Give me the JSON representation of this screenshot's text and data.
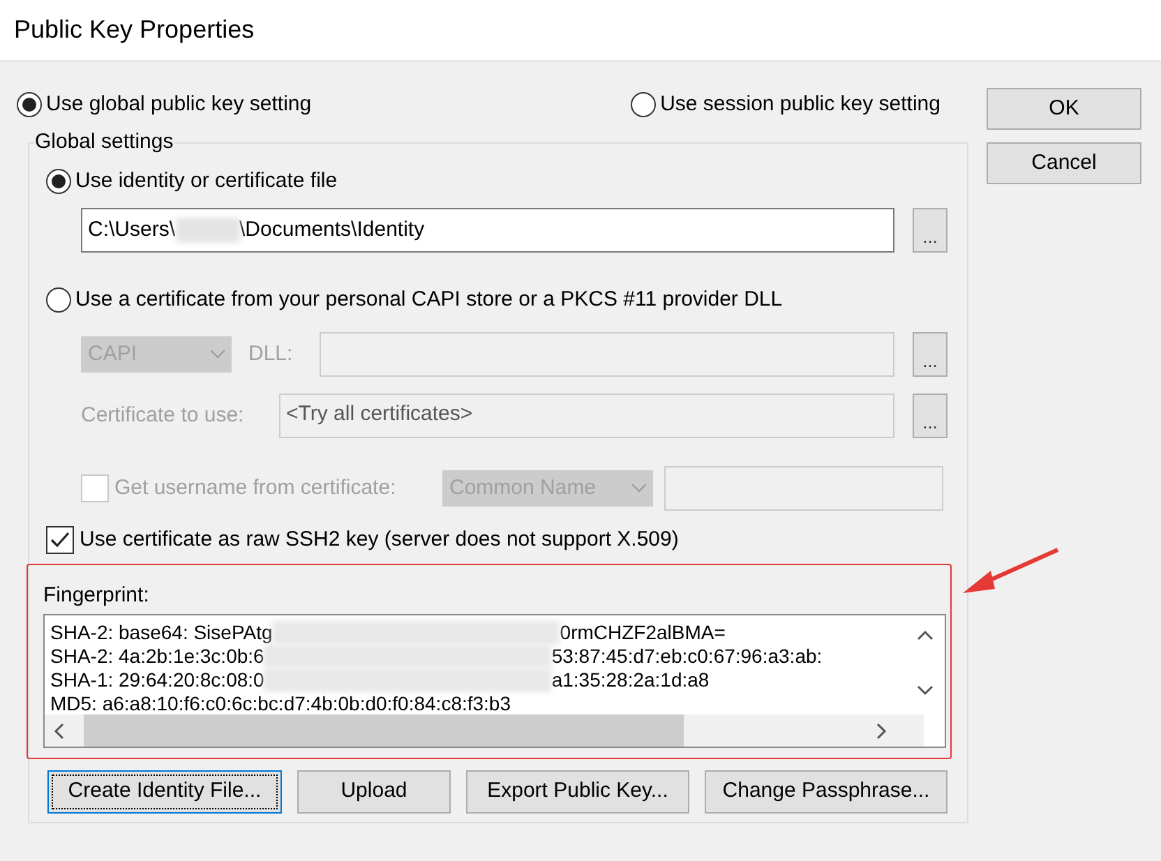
{
  "window": {
    "title": "Public Key Properties"
  },
  "scope_options": [
    {
      "label": "Use global public key setting",
      "selected": true
    },
    {
      "label": "Use session public key setting",
      "selected": false
    }
  ],
  "dialog_buttons": [
    {
      "label": "OK"
    },
    {
      "label": "Cancel"
    }
  ],
  "global_settings": {
    "title": "Global settings",
    "source_options": [
      {
        "label": "Use identity or certificate file",
        "selected": true
      },
      {
        "label": "Use a certificate from your personal CAPI store or a PKCS #11 provider DLL",
        "selected": false
      }
    ],
    "identity_path": {
      "prefix": "C:\\Users\\",
      "suffix": "\\Documents\\Identity",
      "browse": "..."
    },
    "capi": {
      "disabled": true,
      "store": "CAPI",
      "dll_label": "DLL:",
      "dll_browse": "...",
      "cert_label": "Certificate to use:",
      "cert_value": "<Try all certificates>",
      "cert_browse": "...",
      "username_label": "Get username from certificate:",
      "username_checked": false,
      "name_field": "Common Name"
    },
    "raw_ssh2": {
      "label": "Use certificate as raw SSH2 key (server does not support X.509)",
      "checked": true
    },
    "fingerprint": {
      "label": "Fingerprint:",
      "lines": [
        {
          "start": "SHA-2: base64: SisePAtg",
          "end": "0rmCHZF2alBMA="
        },
        {
          "start": "SHA-2: 4a:2b:1e:3c:0b:6",
          "end": "53:87:45:d7:eb:c0:67:96:a3:ab:"
        },
        {
          "start": "SHA-1: 29:64:20:8c:08:0",
          "end": "a1:35:28:2a:1d:a8"
        },
        {
          "start": "MD5: a6:a8:10:f6:c0:6c:bc:d7:4b:0b:d0:f0:84:c8:f3:b3"
        }
      ]
    }
  },
  "buttons": [
    {
      "label": "Create Identity File...",
      "focused": true
    },
    {
      "label": "Upload",
      "focused": false
    },
    {
      "label": "Export Public Key...",
      "focused": false
    },
    {
      "label": "Change Passphrase...",
      "focused": false
    }
  ]
}
